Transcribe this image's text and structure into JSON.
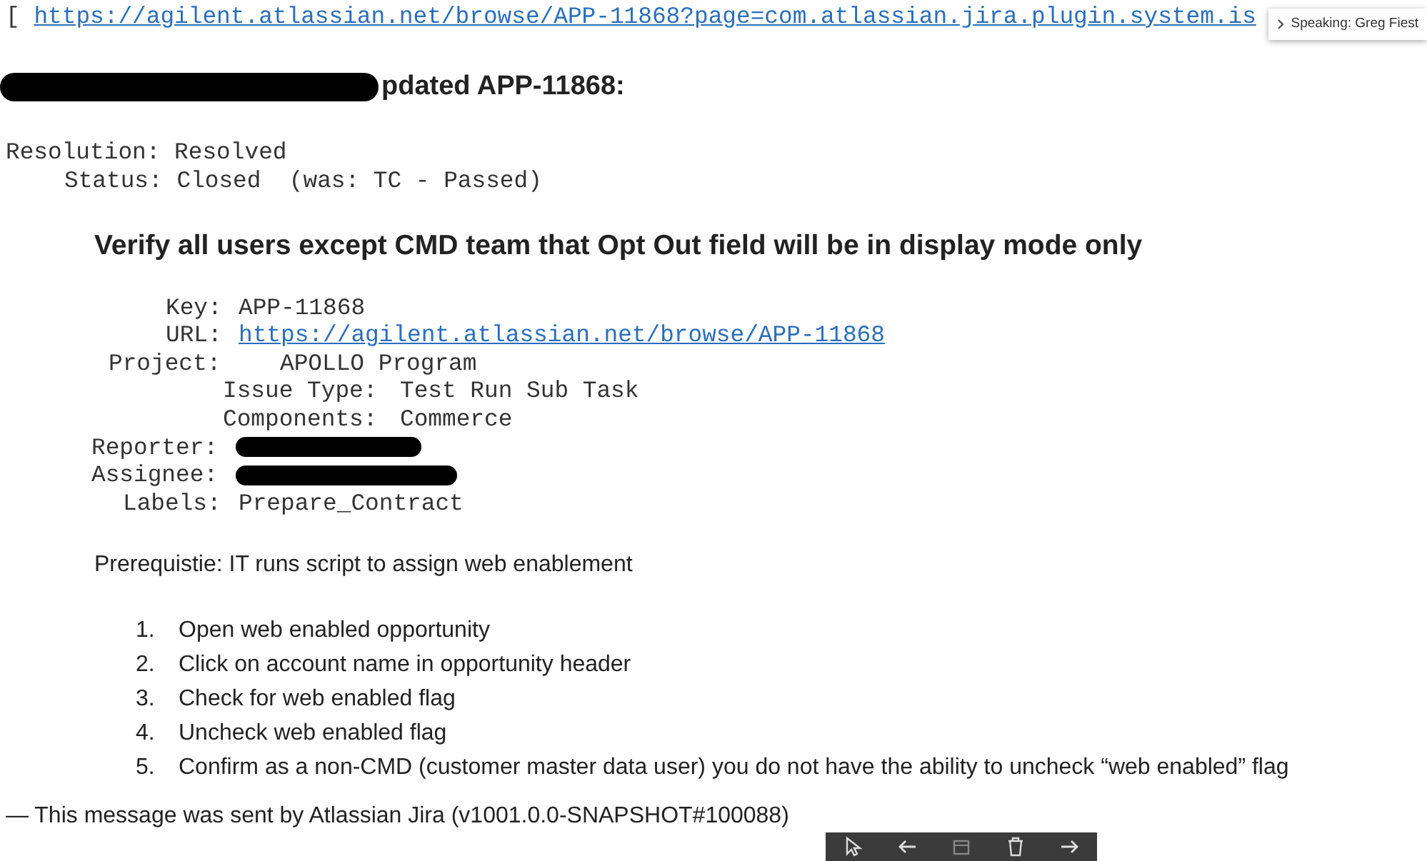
{
  "link_line": {
    "bracket": "[",
    "url": "https://agilent.atlassian.net/browse/APP-11868?page=com.atlassian.jira.plugin.system.is"
  },
  "speaking_popup": {
    "text": "Speaking: Greg Fiest"
  },
  "heading": {
    "text": "pdated APP-11868:",
    "redacted_prefix": true
  },
  "changes": [
    {
      "label": "Resolution:",
      "value": "Resolved"
    },
    {
      "label": "Status:",
      "value": "Closed  (was: TC - Passed)"
    }
  ],
  "summary": "Verify all users except CMD team that Opt Out field will be in display mode only",
  "fields": [
    {
      "label": "Key:",
      "value": "APP-11868",
      "kind": "text"
    },
    {
      "label": "URL:",
      "value": "https://agilent.atlassian.net/browse/APP-11868",
      "kind": "link"
    },
    {
      "label": "Project:",
      "value": "APOLLO Program",
      "kind": "text"
    },
    {
      "label": "Issue Type:",
      "value": "Test Run Sub Task",
      "kind": "text"
    },
    {
      "label": "Components:",
      "value": "Commerce",
      "kind": "text"
    },
    {
      "label": "Reporter:",
      "kind": "redacted"
    },
    {
      "label": "Assignee:",
      "kind": "redacted"
    },
    {
      "label": "Labels:",
      "value": "Prepare_Contract",
      "kind": "text"
    }
  ],
  "prerequisite": "Prerequistie: IT runs script to assign web enablement",
  "steps": [
    {
      "number": "1.",
      "text": "Open web enabled opportunity"
    },
    {
      "number": "2.",
      "text": "Click on account name in opportunity header"
    },
    {
      "number": "3.",
      "text": "Check for web enabled flag"
    },
    {
      "number": "4.",
      "text": "Uncheck web enabled flag"
    },
    {
      "number": "5.",
      "text": "Confirm as a non-CMD (customer master data user) you do not have the ability to uncheck “web enabled” flag"
    }
  ],
  "footer": "— This message was sent by Atlassian Jira (v1001.0.0-SNAPSHOT#100088)",
  "toolbar": [
    {
      "kind": "pointer"
    },
    {
      "kind": "back"
    },
    {
      "kind": "box"
    },
    {
      "kind": "trash"
    },
    {
      "kind": "forward"
    }
  ]
}
